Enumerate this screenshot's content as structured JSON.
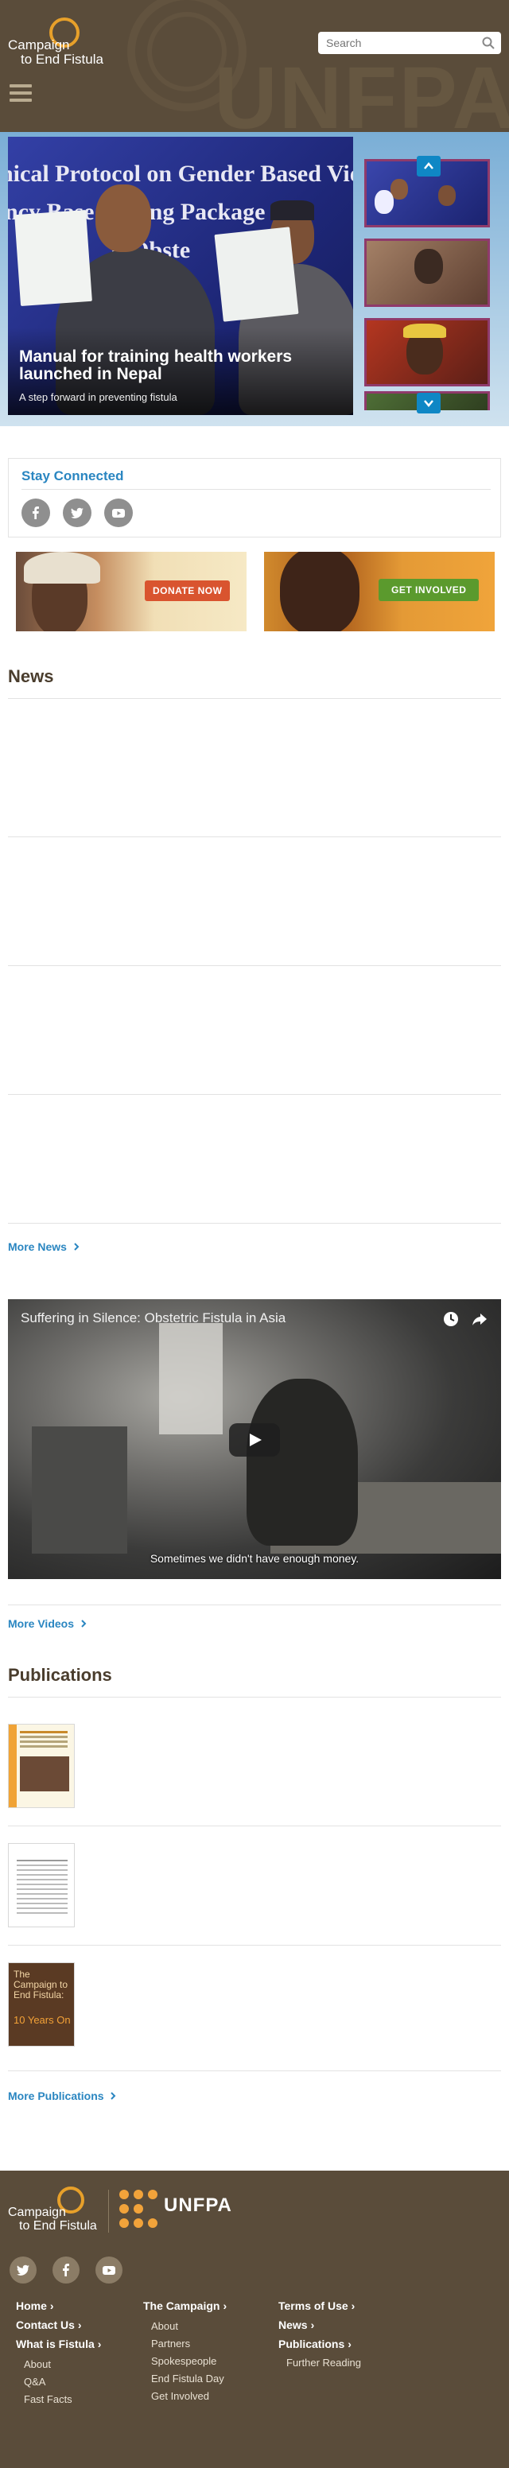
{
  "header": {
    "logo_line1": "Campaign",
    "logo_line2": "to End Fistula",
    "background_wordmark": "UNFPA",
    "search": {
      "placeholder": "Search"
    }
  },
  "hero": {
    "title": "Manual for training health workers launched in Nepal",
    "subtitle": "A step forward in preventing fistula",
    "banner_lines": [
      "nical Protocol on Gender Based Violen",
      "ncy Base  raining Package o",
      "d Obste"
    ]
  },
  "stay_connected": {
    "title": "Stay Connected",
    "icons": [
      "facebook-icon",
      "twitter-icon",
      "youtube-icon"
    ]
  },
  "promos": {
    "donate_label": "DONATE NOW",
    "involved_label": "GET INVOLVED"
  },
  "news": {
    "title": "News",
    "more_label": "More News"
  },
  "video": {
    "title": "Suffering in Silence: Obstetric Fistula in Asia",
    "subtitle": "Sometimes we didn't have enough money.",
    "more_label": "More Videos"
  },
  "publications": {
    "title": "Publications",
    "pub3_cover": "The Campaign to End Fistula:",
    "pub3_years": "10 Years On",
    "more_label": "More Publications"
  },
  "footer": {
    "logo_line1": "Campaign",
    "logo_line2": "to End Fistula",
    "partner": "UNFPA",
    "col1": {
      "home": "Home",
      "contact": "Contact Us",
      "what": "What is Fistula",
      "sub": [
        "About",
        "Q&A",
        "Fast Facts"
      ]
    },
    "col2": {
      "campaign": "The Campaign",
      "sub": [
        "About",
        "Partners",
        "Spokespeople",
        "End Fistula Day",
        "Get Involved"
      ]
    },
    "col3": {
      "terms": "Terms of Use",
      "news": "News",
      "publications": "Publications",
      "sub": [
        "Further Reading"
      ]
    }
  },
  "colors": {
    "brown": "#5a4c3a",
    "accent_blue": "#2a86c1",
    "orange": "#e7a02a"
  }
}
